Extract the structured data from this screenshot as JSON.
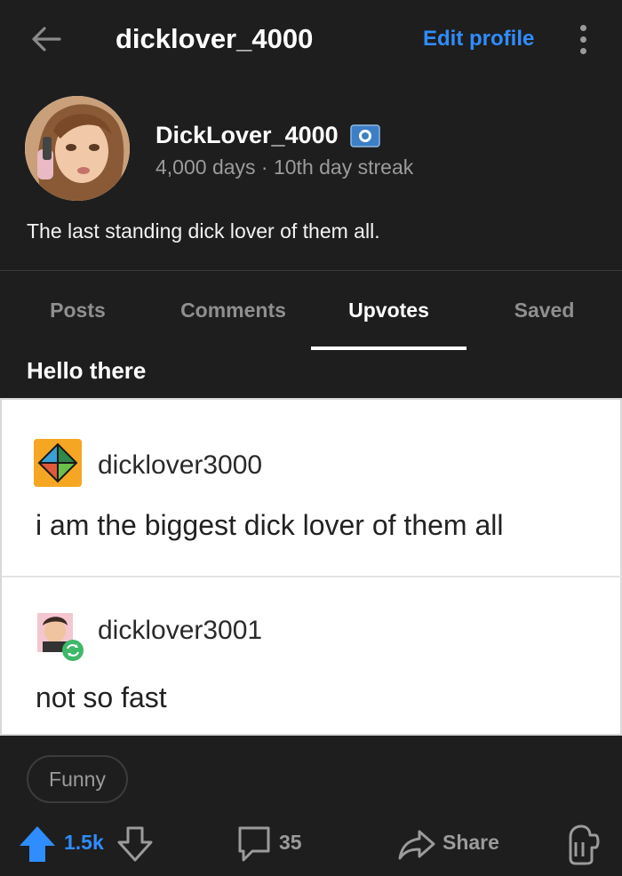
{
  "header": {
    "title": "dicklover_4000",
    "edit_profile_label": "Edit profile",
    "back_icon": "arrow-left-icon",
    "more_icon": "kebab-menu-icon"
  },
  "profile": {
    "display_name": "DickLover_4000",
    "badge_icon": "flag-badge-icon",
    "meta": "4,000 days · 10th day streak",
    "bio": "The last standing dick lover of them all."
  },
  "tabs": [
    {
      "label": "Posts",
      "active": false
    },
    {
      "label": "Comments",
      "active": false
    },
    {
      "label": "Upvotes",
      "active": true
    },
    {
      "label": "Saved",
      "active": false
    }
  ],
  "post": {
    "title": "Hello there",
    "image": {
      "tweets": [
        {
          "username": "dicklover3000",
          "text": "i am the biggest dick lover of them all"
        },
        {
          "username": "dicklover3001",
          "text": "not so fast"
        }
      ]
    },
    "flair": "Funny",
    "votes": "1.5k",
    "comments": "35",
    "share_label": "Share"
  },
  "colors": {
    "background": "#1e1e1e",
    "accent": "#2f8dff",
    "muted": "#9b9b9b"
  }
}
